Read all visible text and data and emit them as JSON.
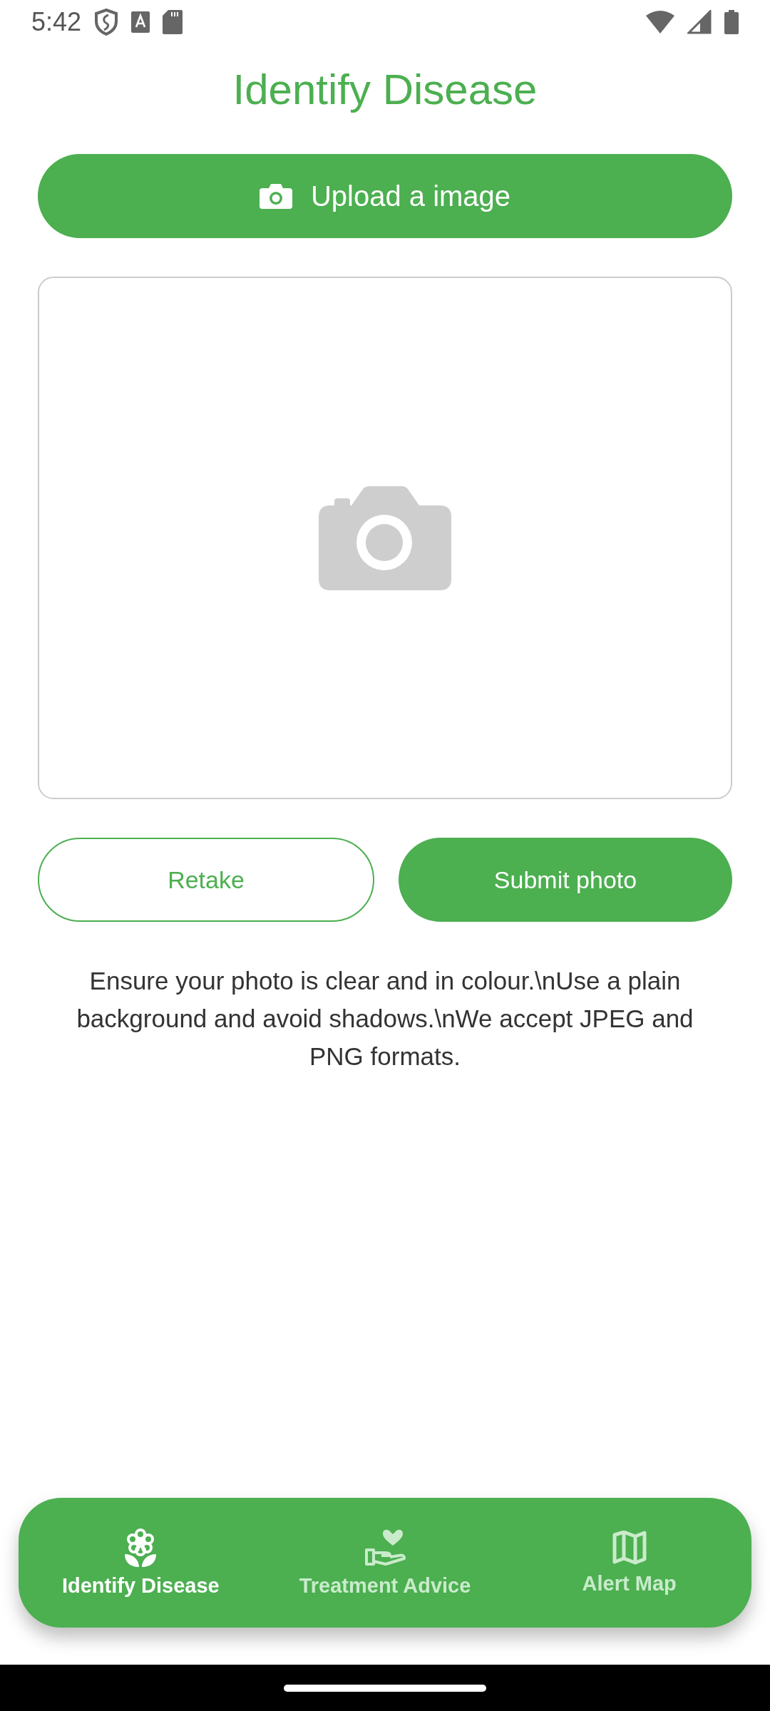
{
  "status_bar": {
    "time": "5:42"
  },
  "title": "Identify Disease",
  "upload_button": {
    "label": "Upload a image"
  },
  "actions": {
    "retake": "Retake",
    "submit": "Submit photo"
  },
  "hint": "Ensure your photo is clear and in colour.\\nUse a plain background and avoid shadows.\\nWe accept JPEG and PNG formats.",
  "bottom_nav": [
    {
      "label": "Identify Disease",
      "kind": "flower",
      "selected": true
    },
    {
      "label": "Treatment Advice",
      "kind": "care",
      "selected": false
    },
    {
      "label": "Alert Map",
      "kind": "map",
      "selected": false
    }
  ]
}
